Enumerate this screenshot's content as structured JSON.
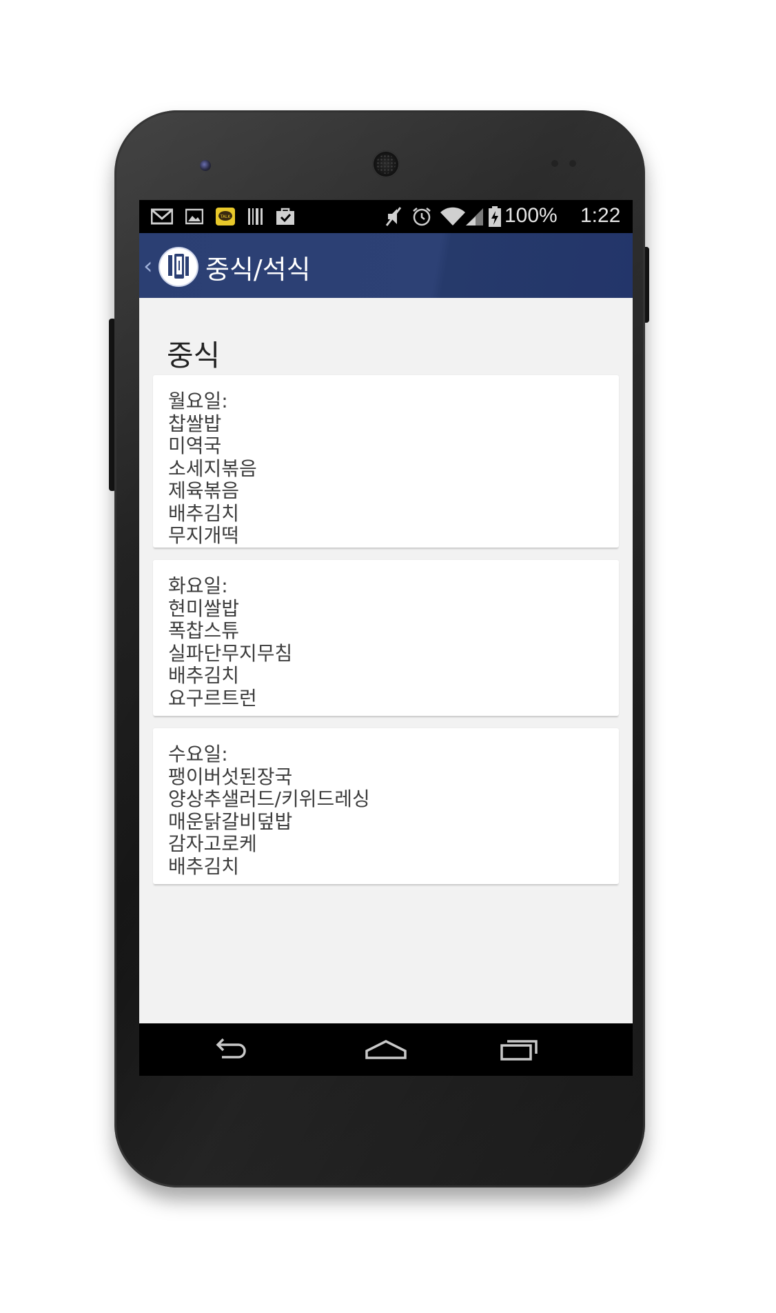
{
  "status_bar": {
    "battery_percent": "100%",
    "time": "1:22",
    "icons": [
      "gmail-icon",
      "gallery-icon",
      "kakaotalk-icon",
      "barcode-icon",
      "shopping-bag-icon",
      "mute-icon",
      "alarm-icon",
      "wifi-icon",
      "signal-icon",
      "battery-charging-icon"
    ],
    "kakaotalk_badge": "TALK"
  },
  "action_bar": {
    "title": "중식/석식",
    "back_icon": "chevron-left-icon",
    "app_icon": "app-logo-icon"
  },
  "content": {
    "section_title": "중식",
    "days": [
      {
        "label": "월요일:",
        "items": [
          "찹쌀밥",
          "미역국",
          "소세지볶음",
          "제육볶음",
          "배추김치",
          "무지개떡"
        ]
      },
      {
        "label": "화요일:",
        "items": [
          "현미쌀밥",
          "폭찹스튜",
          "실파단무지무침",
          "배추김치",
          "요구르트런"
        ]
      },
      {
        "label": "수요일:",
        "items": [
          "팽이버섯된장국",
          "양상추샐러드/키위드레싱",
          "매운닭갈비덮밥",
          "감자고로케",
          "배추김치"
        ]
      }
    ]
  },
  "nav_bar": {
    "icons": [
      "back-arrow-icon",
      "home-icon",
      "recent-apps-icon"
    ]
  },
  "colors": {
    "action_bar": "#2b3f73",
    "screen_bg": "#f2f2f2",
    "card_bg": "#ffffff",
    "text": "#3c3c3c"
  }
}
